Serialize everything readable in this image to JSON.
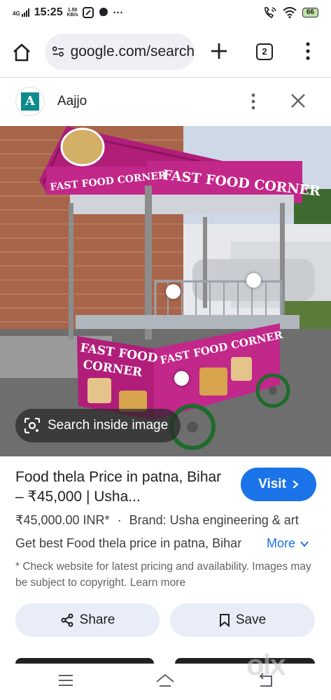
{
  "status_bar": {
    "network": "4G",
    "time": "15:25",
    "speed_value": "1.50",
    "speed_unit": "KB/s",
    "more": "···",
    "battery": "66"
  },
  "browser": {
    "url": "google.com/search",
    "tab_count": "2"
  },
  "source": {
    "logo_letter": "A",
    "name": "Aajjo"
  },
  "image": {
    "search_inside_label": "Search inside image"
  },
  "result": {
    "title": "Food thela Price in patna, Bihar – ₹45,000 | Usha...",
    "visit_label": "Visit",
    "price": "₹45,000.00 INR*",
    "separator": "·",
    "brand": "Brand: Usha engineering & art",
    "description": "Get best Food thela price in patna, Bihar",
    "more_label": "More",
    "note": "* Check website for latest pricing and availability. Images may be subject to copyright. Learn more"
  },
  "actions": {
    "share_label": "Share",
    "save_label": "Save"
  },
  "watermark": "olx",
  "colors": {
    "accent": "#1a73e8",
    "pill_bg": "#eef0f6",
    "button_bg": "#e8edf7",
    "cart_magenta": "#b01e7a"
  }
}
